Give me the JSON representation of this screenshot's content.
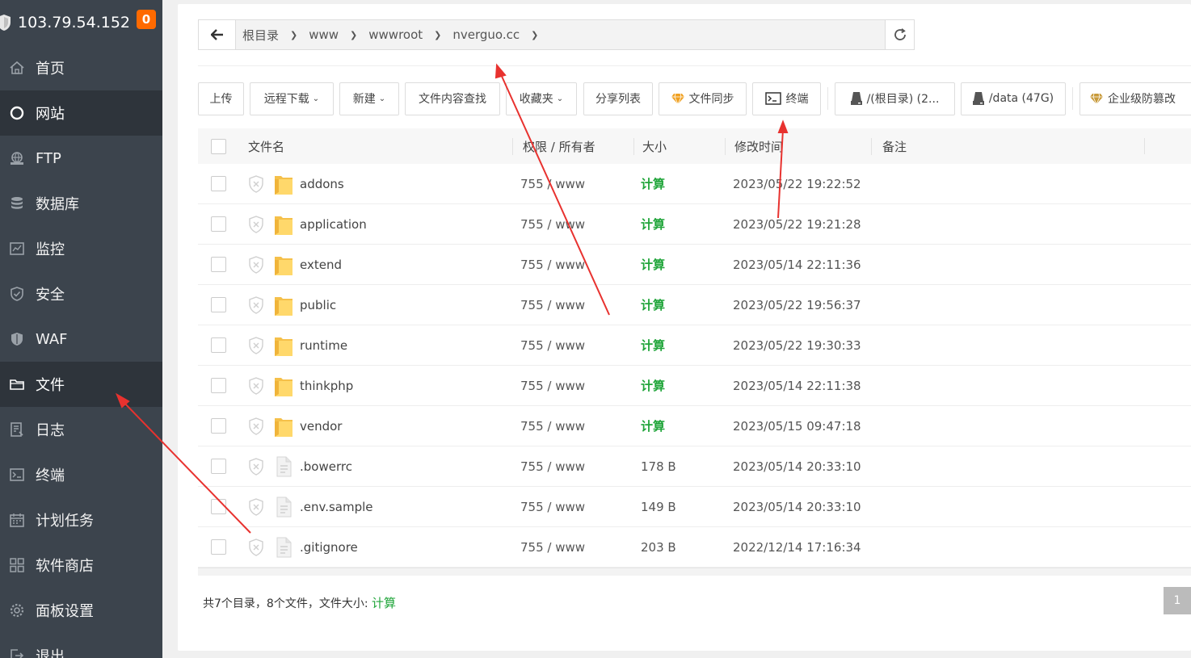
{
  "server": {
    "ip": "103.79.54.152",
    "badge": "0"
  },
  "sidebar": {
    "items": [
      {
        "label": "首页",
        "icon": "home-icon"
      },
      {
        "label": "网站",
        "icon": "globe-icon"
      },
      {
        "label": "FTP",
        "icon": "ftp-icon"
      },
      {
        "label": "数据库",
        "icon": "database-icon"
      },
      {
        "label": "监控",
        "icon": "monitor-icon"
      },
      {
        "label": "安全",
        "icon": "shield-icon"
      },
      {
        "label": "WAF",
        "icon": "waf-icon"
      },
      {
        "label": "文件",
        "icon": "folder-icon"
      },
      {
        "label": "日志",
        "icon": "log-icon"
      },
      {
        "label": "终端",
        "icon": "terminal-icon"
      },
      {
        "label": "计划任务",
        "icon": "calendar-icon"
      },
      {
        "label": "软件商店",
        "icon": "apps-icon"
      },
      {
        "label": "面板设置",
        "icon": "gear-icon"
      },
      {
        "label": "退出",
        "icon": "logout-icon"
      }
    ]
  },
  "breadcrumb": [
    "根目录",
    "www",
    "wwwroot",
    "nverguo.cc"
  ],
  "toolbar": {
    "upload": "上传",
    "remote_download": "远程下载",
    "new": "新建",
    "content_search": "文件内容查找",
    "favorites": "收藏夹",
    "share_list": "分享列表",
    "file_sync": "文件同步",
    "terminal": "终端",
    "disk_root": "/(根目录) (2...",
    "disk_data": "/data (47G)",
    "tamper": "企业级防篡改"
  },
  "table": {
    "headers": {
      "name": "文件名",
      "perm": "权限 / 所有者",
      "size": "大小",
      "mtime": "修改时间",
      "note": "备注"
    },
    "rows": [
      {
        "name": "addons",
        "type": "dir",
        "perm": "755 / www",
        "size": "计算",
        "mtime": "2023/05/22 19:22:52"
      },
      {
        "name": "application",
        "type": "dir",
        "perm": "755 / www",
        "size": "计算",
        "mtime": "2023/05/22 19:21:28"
      },
      {
        "name": "extend",
        "type": "dir",
        "perm": "755 / www",
        "size": "计算",
        "mtime": "2023/05/14 22:11:36"
      },
      {
        "name": "public",
        "type": "dir",
        "perm": "755 / www",
        "size": "计算",
        "mtime": "2023/05/22 19:56:37"
      },
      {
        "name": "runtime",
        "type": "dir",
        "perm": "755 / www",
        "size": "计算",
        "mtime": "2023/05/22 19:30:33"
      },
      {
        "name": "thinkphp",
        "type": "dir",
        "perm": "755 / www",
        "size": "计算",
        "mtime": "2023/05/14 22:11:38"
      },
      {
        "name": "vendor",
        "type": "dir",
        "perm": "755 / www",
        "size": "计算",
        "mtime": "2023/05/15 09:47:18"
      },
      {
        "name": ".bowerrc",
        "type": "file",
        "perm": "755 / www",
        "size": "178 B",
        "mtime": "2023/05/14 20:33:10"
      },
      {
        "name": ".env.sample",
        "type": "file",
        "perm": "755 / www",
        "size": "149 B",
        "mtime": "2023/05/14 20:33:10"
      },
      {
        "name": ".gitignore",
        "type": "file",
        "perm": "755 / www",
        "size": "203 B",
        "mtime": "2022/12/14 17:16:34"
      }
    ]
  },
  "summary": {
    "text": "共7个目录，8个文件，文件大小: ",
    "calc": "计算"
  },
  "pager": {
    "current": "1"
  },
  "colors": {
    "sidebar_bg": "#3c444d",
    "accent_green": "#20a53a",
    "badge_orange": "#ff6a00",
    "annotation_red": "#e8322f"
  }
}
